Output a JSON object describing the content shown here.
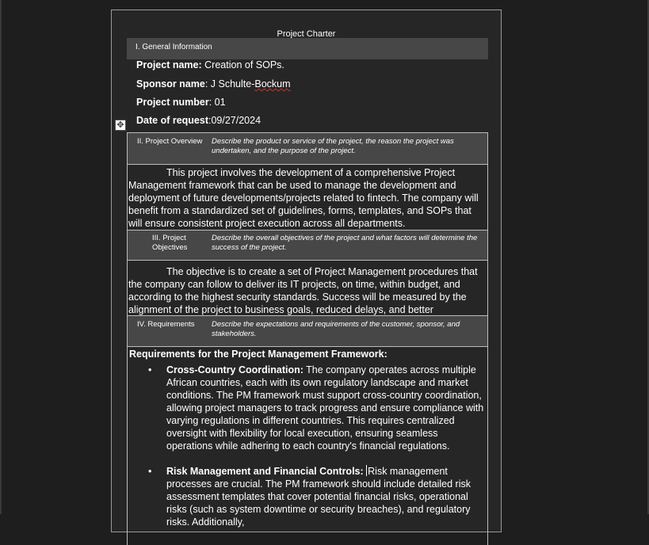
{
  "document": {
    "title": "Project Charter",
    "general_information": {
      "heading": "I. General Information",
      "project_name_label": "Project name:",
      "project_name_value": " Creation of SOPs.",
      "sponsor_label": "Sponsor name",
      "sponsor_value_prefix": ": J Schulte-",
      "sponsor_value_misspelled": "Bockum",
      "project_number_label": "Project number",
      "project_number_value": ": 01",
      "date_label": "Date of request",
      "date_value": ":09/27/2024"
    },
    "overview": {
      "heading": "II. Project Overview",
      "description": "Describe the product or service of the project, the reason the project was undertaken, and the purpose of the project.",
      "body": "This project involves the development of a comprehensive Project Management framework that can be used to manage the development and deployment of future developments/projects related to fintech. The company will benefit from a standardized set of guidelines, forms, templates, and SOPs that will ensure consistent project execution across all departments."
    },
    "objectives": {
      "heading_line1": "III.  Project",
      "heading_line2": "Objectives",
      "description": "Describe the overall objectives of the project and what factors will determine the success of the project.",
      "body": "The objective is to create a set of Project Management procedures that the company can follow to deliver its IT projects, on time, within budget, and according to the highest security standards. Success will be measured by the alignment of the project to business goals, reduced delays, and better coordination across teams."
    },
    "requirements": {
      "heading": "IV.  Requirements",
      "description": "Describe the expectations and requirements of the customer, sponsor, and stakeholders.",
      "title": "Requirements for the Project Management Framework:",
      "items": [
        {
          "bold": "Cross-Country Coordination:",
          "text": " The company operates across multiple African countries, each with its own regulatory landscape and market conditions. The PM framework must support cross-country coordination, allowing project managers to track progress and ensure compliance with varying regulations in different countries. This requires centralized oversight with flexibility for local execution, ensuring seamless operations while adhering to each country's financial regulations."
        },
        {
          "bold": "Risk Management and Financial Controls:",
          "text": "Risk management processes are crucial. The PM framework should include detailed risk assessment templates that cover potential financial risks, operational risks (such as system downtime or security breaches), and regulatory risks. Additionally,"
        }
      ]
    },
    "bullet_glyph": "•",
    "move_handle_glyph": "✥"
  }
}
